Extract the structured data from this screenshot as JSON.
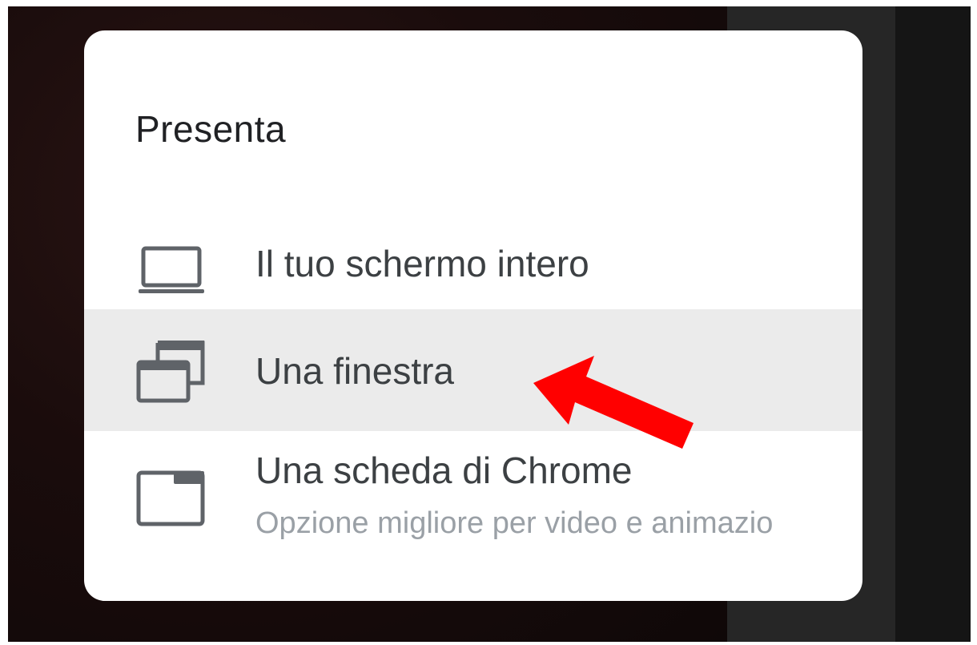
{
  "dialog": {
    "title": "Presenta",
    "options": [
      {
        "label": "Il tuo schermo intero",
        "icon": "laptop-icon"
      },
      {
        "label": "Una finestra",
        "icon": "window-icon"
      },
      {
        "label": "Una scheda di Chrome",
        "sublabel": "Opzione migliore per video e animazio",
        "icon": "tab-icon"
      }
    ]
  },
  "annotation": {
    "arrow_color": "#ff0000"
  },
  "colors": {
    "highlight": "#ebebeb",
    "icon": "#5f6368"
  }
}
